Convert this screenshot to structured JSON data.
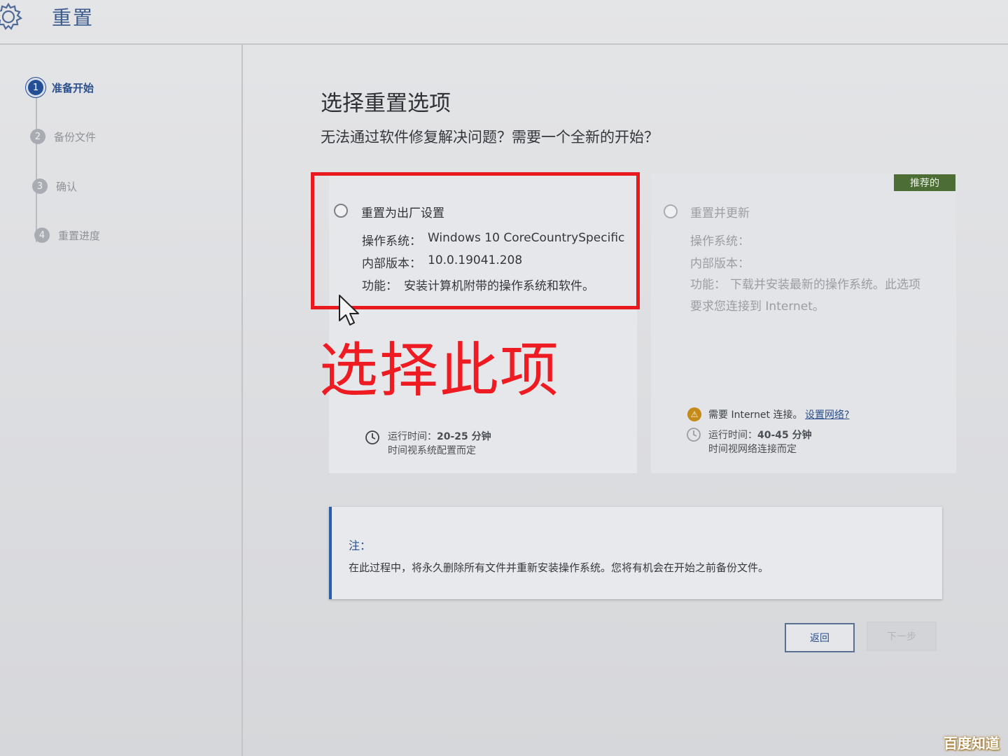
{
  "app": {
    "title": "重置",
    "icon": "gear-icon"
  },
  "sidebar": {
    "steps": [
      {
        "number": "1",
        "label": "准备开始",
        "active": true
      },
      {
        "number": "2",
        "label": "备份文件",
        "active": false
      },
      {
        "number": "3",
        "label": "确认",
        "active": false
      },
      {
        "number": "4",
        "label": "重置进度",
        "active": false
      }
    ]
  },
  "main": {
    "title": "选择重置选项",
    "subtitle": "无法通过软件修复解决问题？需要一个全新的开始？"
  },
  "options": {
    "factory": {
      "title": "重置为出厂设置",
      "os_label": "操作系统：",
      "os_value": "Windows 10 CoreCountrySpecific",
      "build_label": "内部版本：",
      "build_value": "10.0.19041.208",
      "feature_label": "功能：",
      "feature_value": "安装计算机附带的操作系统和软件。",
      "time_label": "运行时间：",
      "time_value": "20-25 分钟",
      "time_note": "时间视系统配置而定",
      "selected": false
    },
    "update": {
      "badge": "推荐的",
      "title": "重置并更新",
      "os_label": "操作系统：",
      "build_label": "内部版本：",
      "feature_label": "功能：",
      "feature_value": "下载并安装最新的操作系统。此选项",
      "feature_value_line2": "要求您连接到 Internet。",
      "internet_notice": "需要 Internet 连接。",
      "internet_link": "设置网络?",
      "time_label": "运行时间：",
      "time_value": "40-45 分钟",
      "time_note": "时间视网络连接而定",
      "selected": false
    }
  },
  "annotation": {
    "text": "选择此项",
    "color": "#ee1c22"
  },
  "note": {
    "label": "注：",
    "text": "在此过程中，将永久删除所有文件并重新安装操作系统。您将有机会在开始之前备份文件。"
  },
  "buttons": {
    "back": "返回",
    "next": "下一步"
  },
  "watermark": {
    "text": "百度知道"
  },
  "colors": {
    "accent": "#2b4f8c",
    "badge_green": "#4c6e35",
    "annotation_red": "#e8191f"
  }
}
